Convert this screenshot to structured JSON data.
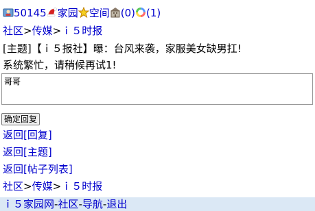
{
  "header": {
    "uid": "50145",
    "home_label": "家园",
    "space_label": "空间",
    "msg_count": "(0)",
    "notice_count": "(1)"
  },
  "breadcrumb_top": {
    "root": "社区",
    "sep1": ">",
    "channel": "传媒",
    "sep2": ">",
    "board": "ｉ５时报"
  },
  "post": {
    "tag": "[主题]",
    "title": "【ｉ５报社】曝：台风来袭，家服美女缺男扛!"
  },
  "error_message": "系统繁忙，请稍候再试1!",
  "reply": {
    "value": "哥哥",
    "submit_label": "确定回复"
  },
  "nav_links": {
    "back_reply": "返回[回复]",
    "back_topic": "返回[主题]",
    "back_list": "返回[帖子列表]"
  },
  "breadcrumb_bottom": {
    "root": "社区",
    "sep1": ">",
    "channel": "传媒",
    "sep2": ">",
    "board": "ｉ５时报"
  },
  "footer": {
    "site": "ｉ５家园网",
    "d1": "-",
    "community": "社区",
    "d2": "-",
    "nav": "导航",
    "d3": "-",
    "logout": "退出"
  },
  "icons": [
    "user-icon",
    "santa-hat-icon",
    "star-icon",
    "mailbox-icon",
    "color-ring-icon"
  ]
}
